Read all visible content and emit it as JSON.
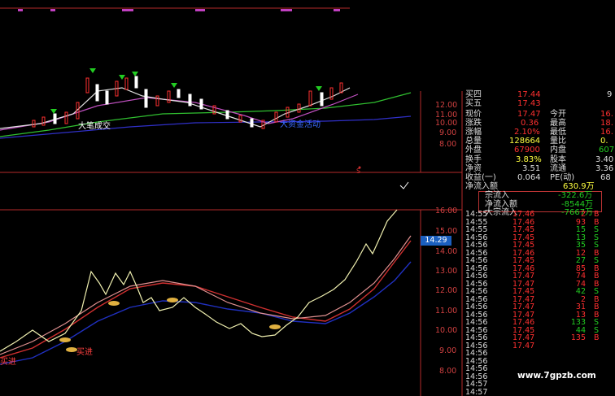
{
  "colors": {
    "background": "#000000",
    "axis": "#b32a2a",
    "price_up": "#ff3030",
    "price_flat": "#dddddd",
    "volume_green": "#22cc22",
    "highlight_white": "#ffffff",
    "line_blue": "#2030c0",
    "line_yellow": "#f0f0a0",
    "line_magenta": "#c050c0"
  },
  "upper_chart": {
    "annotations": [
      "大笔成交",
      "大资金活动"
    ],
    "y_ticks": [
      "12.00",
      "11.00",
      "10.00",
      "9.00",
      "8.00"
    ]
  },
  "lower_chart": {
    "annotations": [
      "买进",
      "买进"
    ],
    "y_ticks": [
      "16.00",
      "15.00",
      "14.00",
      "13.00",
      "12.00",
      "11.00",
      "10.00",
      "9.00",
      "8.00"
    ],
    "current_price_tag": "14.29"
  },
  "small_marker": "S",
  "quote": {
    "rows": [
      {
        "label": "买四",
        "value": "17.44",
        "label2": "",
        "value2": "",
        "extra": "9"
      },
      {
        "label": "买五",
        "value": "17.43",
        "label2": "",
        "value2": "",
        "extra": ""
      },
      {
        "label": "现价",
        "value": "17.47",
        "label2": "今开",
        "value2": "16."
      },
      {
        "label": "涨跌",
        "value": "0.36",
        "label2": "最高",
        "value2": "18."
      },
      {
        "label": "涨幅",
        "value": "2.10%",
        "label2": "最低",
        "value2": "16."
      },
      {
        "label": "总量",
        "value": "128664",
        "label2": "量比",
        "value2": "0."
      },
      {
        "label": "外盘",
        "value": "67900",
        "label2": "内盘",
        "value2": "607"
      },
      {
        "label": "换手",
        "value": "3.83%",
        "label2": "股本",
        "value2": "3.40"
      },
      {
        "label": "净资",
        "value": "3.51",
        "label2": "流通",
        "value2": "3.36"
      },
      {
        "label": "收益(一)",
        "value": "0.064",
        "label2": "PE(动)",
        "value2": "68"
      }
    ],
    "flow_title": "净流入额",
    "flow_title_value": "630.9万",
    "flow_rows": [
      {
        "label": "宗流入",
        "value": "-322.6万"
      },
      {
        "label": "净流入额",
        "value": "-8544万"
      },
      {
        "label": "大宗流入",
        "value": "-7667万"
      }
    ]
  },
  "ticks": [
    {
      "time": "14:55",
      "price": "17.46",
      "vol": "2",
      "side": "B"
    },
    {
      "time": "14:55",
      "price": "17.46",
      "vol": "93",
      "side": "B"
    },
    {
      "time": "14:55",
      "price": "17.45",
      "vol": "15",
      "side": "S"
    },
    {
      "time": "14:56",
      "price": "17.45",
      "vol": "13",
      "side": "S"
    },
    {
      "time": "14:56",
      "price": "17.45",
      "vol": "35",
      "side": "S"
    },
    {
      "time": "14:56",
      "price": "17.46",
      "vol": "12",
      "side": "B"
    },
    {
      "time": "14:56",
      "price": "17.45",
      "vol": "27",
      "side": "S"
    },
    {
      "time": "14:56",
      "price": "17.46",
      "vol": "85",
      "side": "B"
    },
    {
      "time": "14:56",
      "price": "17.47",
      "vol": "74",
      "side": "B"
    },
    {
      "time": "14:56",
      "price": "17.47",
      "vol": "74",
      "side": "B"
    },
    {
      "time": "14:56",
      "price": "17.45",
      "vol": "42",
      "side": "S"
    },
    {
      "time": "14:56",
      "price": "17.47",
      "vol": "2",
      "side": "B"
    },
    {
      "time": "14:56",
      "price": "17.47",
      "vol": "31",
      "side": "B"
    },
    {
      "time": "14:56",
      "price": "17.47",
      "vol": "13",
      "side": "B"
    },
    {
      "time": "14:56",
      "price": "17.46",
      "vol": "133",
      "side": "S"
    },
    {
      "time": "14:56",
      "price": "17.45",
      "vol": "44",
      "side": "S"
    },
    {
      "time": "14:56",
      "price": "17.47",
      "vol": "135",
      "side": "B"
    },
    {
      "time": "14:56",
      "price": "17.47",
      "vol": "",
      "side": ""
    },
    {
      "time": "14:56",
      "price": "",
      "vol": "",
      "side": ""
    },
    {
      "time": "14:56",
      "price": "",
      "vol": "",
      "side": ""
    },
    {
      "time": "14:56",
      "price": "",
      "vol": "",
      "side": ""
    },
    {
      "time": "14:56",
      "price": "",
      "vol": "",
      "side": ""
    },
    {
      "time": "14:57",
      "price": "",
      "vol": "",
      "side": ""
    },
    {
      "time": "14:57",
      "price": "",
      "vol": "",
      "side": ""
    }
  ],
  "watermark": "www.7gpzb.com"
}
